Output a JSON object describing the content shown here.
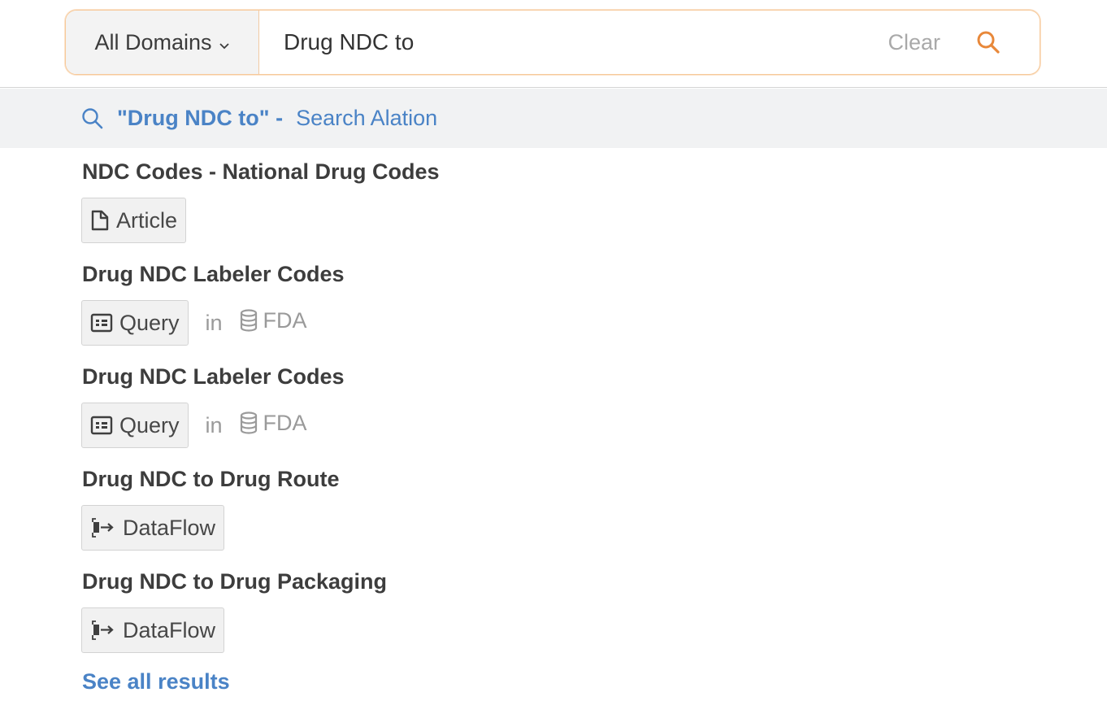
{
  "search": {
    "domain_label": "All Domains",
    "query_value": "Drug NDC to",
    "clear_label": "Clear"
  },
  "suggestion": {
    "quoted_query": "\"Drug NDC to\" -",
    "action_label": "Search Alation"
  },
  "results": [
    {
      "title": "NDC Codes - National Drug Codes",
      "type": "Article",
      "type_icon": "article-icon",
      "in_label": "",
      "source": ""
    },
    {
      "title": "Drug NDC Labeler Codes",
      "type": "Query",
      "type_icon": "query-icon",
      "in_label": "in",
      "source": "FDA",
      "source_icon": "database-icon"
    },
    {
      "title": "Drug NDC Labeler Codes",
      "type": "Query",
      "type_icon": "query-icon",
      "in_label": "in",
      "source": "FDA",
      "source_icon": "database-icon"
    },
    {
      "title": "Drug NDC to Drug Route",
      "type": "DataFlow",
      "type_icon": "dataflow-icon",
      "in_label": "",
      "source": ""
    },
    {
      "title": "Drug NDC to Drug Packaging",
      "type": "DataFlow",
      "type_icon": "dataflow-icon",
      "in_label": "",
      "source": ""
    }
  ],
  "see_all_label": "See all results",
  "colors": {
    "accent_orange": "#e8883a",
    "link_blue": "#4a83c6"
  }
}
